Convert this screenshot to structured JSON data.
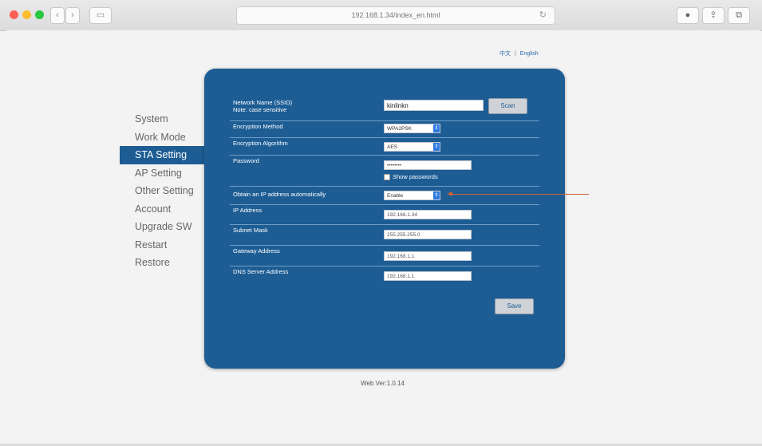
{
  "browser": {
    "url": "192.168.1.34/index_en.html",
    "window_controls": {
      "close_color": "#fd5f57",
      "minimize_color": "#febc2e",
      "zoom_color": "#28c840"
    },
    "icons": {
      "back": "chevron-left-icon",
      "forward": "chevron-right-icon",
      "sidebar": "sidebar-icon",
      "reload": "reload-icon",
      "extension": "extension-icon",
      "share": "share-icon",
      "tabs": "tabs-icon"
    }
  },
  "language": {
    "chinese": "中文",
    "separator": "|",
    "english": "English"
  },
  "sidebar": {
    "items": [
      {
        "label": "System"
      },
      {
        "label": "Work Mode"
      },
      {
        "label": "STA Setting"
      },
      {
        "label": "AP Setting"
      },
      {
        "label": "Other Setting"
      },
      {
        "label": "Account"
      },
      {
        "label": "Upgrade SW"
      },
      {
        "label": "Restart"
      },
      {
        "label": "Restore"
      }
    ],
    "active": "STA Setting"
  },
  "form": {
    "ssid_label": "Network Name (SSID)",
    "ssid_note": "Note: case sensitive",
    "ssid_value": "kinlinkn",
    "scan_label": "Scan",
    "encryption_method_label": "Encryption Method",
    "encryption_method_value": "WPA2PSK",
    "encryption_algorithm_label": "Encryption Algorithm",
    "encryption_algorithm_value": "AES",
    "password_label": "Password",
    "password_value": "••••••••",
    "show_passwords_label": "Show passwords",
    "dhcp_label": "Obtain an IP address automatically",
    "dhcp_value": "Enable",
    "ip_label": "IP Address",
    "ip_value": "192.168.1.34",
    "subnet_label": "Subnet Mask",
    "subnet_value": "255.255.255.0",
    "gateway_label": "Gateway Address",
    "gateway_value": "192.168.1.1",
    "dns_label": "DNS Server Address",
    "dns_value": "192.168.1.1",
    "save_label": "Save"
  },
  "footer": {
    "version": "Web Ver:1.0.14"
  },
  "colors": {
    "panel": "#1d5d94",
    "annotation_arrow": "#d0633a",
    "select_arrow": "#2f7be0"
  }
}
